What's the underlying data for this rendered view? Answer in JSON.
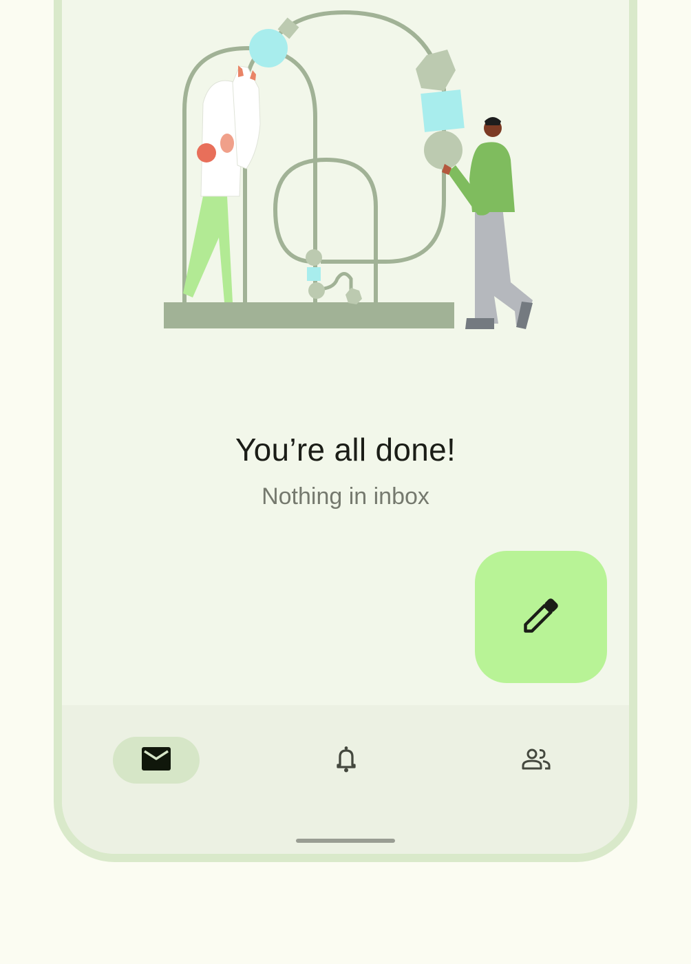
{
  "empty_state": {
    "title": "You’re all done!",
    "subtitle": "Nothing in inbox",
    "illustration_icon": "people-building-arches-illustration"
  },
  "fab": {
    "icon": "pencil-icon",
    "color": "#b8f396"
  },
  "bottom_nav": {
    "items": [
      {
        "name": "inbox",
        "icon": "mail-icon",
        "active": true
      },
      {
        "name": "notifications",
        "icon": "bell-icon",
        "active": false
      },
      {
        "name": "contacts",
        "icon": "people-icon",
        "active": false
      }
    ],
    "active_color": "#d6e6c7"
  },
  "colors": {
    "background": "#fbfcf2",
    "surface": "#f2f7ea",
    "frame": "#d9e9ca",
    "nav_surface": "#ecf1e3"
  }
}
